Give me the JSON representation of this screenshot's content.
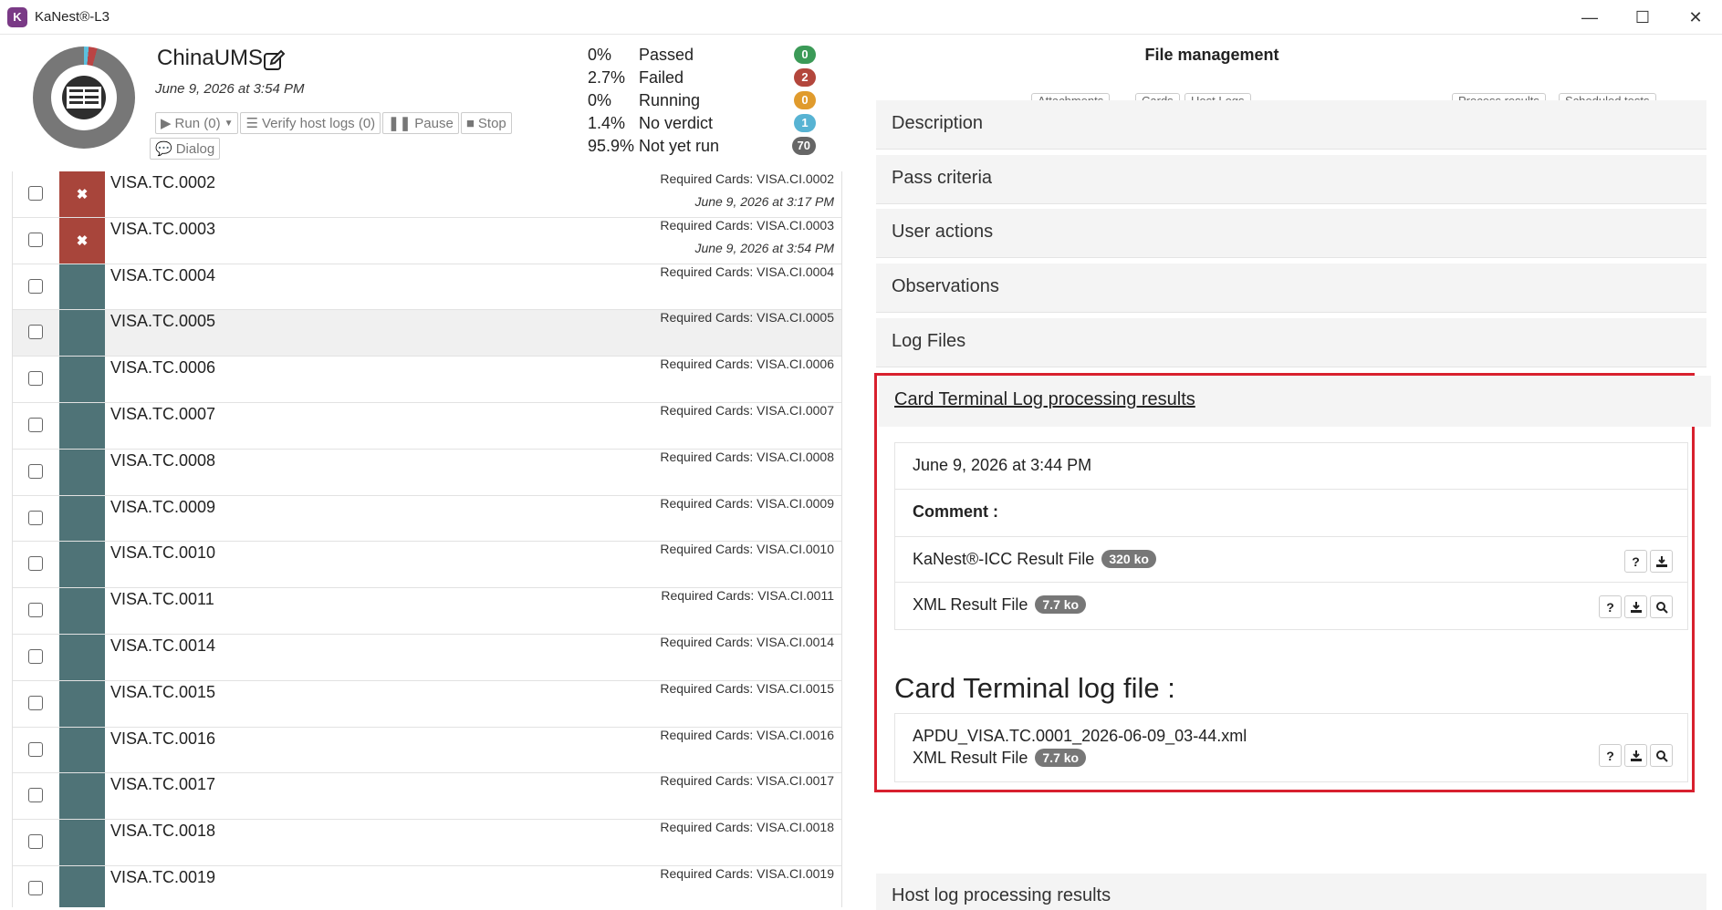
{
  "window": {
    "title": "KaNest®-L3",
    "controls": [
      "—",
      "☐",
      "✕"
    ]
  },
  "project": {
    "name": "ChinaUMS",
    "date": "June 9, 2026 at 3:54 PM",
    "buttons": {
      "run": "Run (0)",
      "verify": "Verify host logs (0)",
      "pause": "Pause",
      "stop": "Stop",
      "dialog": "Dialog"
    }
  },
  "stats": [
    {
      "pct": "0%",
      "label": "Passed",
      "count": "0",
      "color": "#3b9a57"
    },
    {
      "pct": "2.7%",
      "label": "Failed",
      "count": "2",
      "color": "#b3463c"
    },
    {
      "pct": "0%",
      "label": "Running",
      "count": "0",
      "color": "#e09b2d"
    },
    {
      "pct": "1.4%",
      "label": "No verdict",
      "count": "1",
      "color": "#57b3d3"
    },
    {
      "pct": "95.9%",
      "label": "Not yet run",
      "count": "70",
      "color": "#666666"
    }
  ],
  "testcases": [
    {
      "name": "VISA.TC.0002",
      "req": "Required Cards: VISA.CI.0002",
      "date": "June 9, 2026 at 3:17 PM",
      "status": "failed"
    },
    {
      "name": "VISA.TC.0003",
      "req": "Required Cards: VISA.CI.0003",
      "date": "June 9, 2026 at 3:54 PM",
      "status": "failed"
    },
    {
      "name": "VISA.TC.0004",
      "req": "Required Cards: VISA.CI.0004",
      "date": "",
      "status": "notrun"
    },
    {
      "name": "VISA.TC.0005",
      "req": "Required Cards: VISA.CI.0005",
      "date": "",
      "status": "notrun"
    },
    {
      "name": "VISA.TC.0006",
      "req": "Required Cards: VISA.CI.0006",
      "date": "",
      "status": "notrun"
    },
    {
      "name": "VISA.TC.0007",
      "req": "Required Cards: VISA.CI.0007",
      "date": "",
      "status": "notrun"
    },
    {
      "name": "VISA.TC.0008",
      "req": "Required Cards: VISA.CI.0008",
      "date": "",
      "status": "notrun"
    },
    {
      "name": "VISA.TC.0009",
      "req": "Required Cards: VISA.CI.0009",
      "date": "",
      "status": "notrun"
    },
    {
      "name": "VISA.TC.0010",
      "req": "Required Cards: VISA.CI.0010",
      "date": "",
      "status": "notrun"
    },
    {
      "name": "VISA.TC.0011",
      "req": "Required Cards: VISA.CI.0011",
      "date": "",
      "status": "notrun"
    },
    {
      "name": "VISA.TC.0014",
      "req": "Required Cards: VISA.CI.0014",
      "date": "",
      "status": "notrun"
    },
    {
      "name": "VISA.TC.0015",
      "req": "Required Cards: VISA.CI.0015",
      "date": "",
      "status": "notrun"
    },
    {
      "name": "VISA.TC.0016",
      "req": "Required Cards: VISA.CI.0016",
      "date": "",
      "status": "notrun"
    },
    {
      "name": "VISA.TC.0017",
      "req": "Required Cards: VISA.CI.0017",
      "date": "",
      "status": "notrun"
    },
    {
      "name": "VISA.TC.0018",
      "req": "Required Cards: VISA.CI.0018",
      "date": "",
      "status": "notrun"
    },
    {
      "name": "VISA.TC.0019",
      "req": "Required Cards: VISA.CI.0019",
      "date": "",
      "status": "notrun"
    }
  ],
  "file_management": {
    "title": "File management",
    "peek_tabs": [
      "Attachments",
      "Cards",
      "Host Logs",
      "Process results",
      "Scheduled tests"
    ],
    "sections": [
      "Description",
      "Pass criteria",
      "User actions",
      "Observations",
      "Log Files"
    ],
    "ct_results": {
      "title": "Card Terminal Log processing results",
      "date": "June 9, 2026 at 3:44 PM",
      "comment_label": "Comment :",
      "files": [
        {
          "label": "KaNest®-ICC Result File",
          "size": "320 ko"
        },
        {
          "label": "XML Result File",
          "size": "7.7 ko"
        }
      ]
    },
    "ct_log": {
      "title": "Card Terminal log file :",
      "filename": "APDU_VISA.TC.0001_2026-06-09_03-44.xml",
      "xml_label": "XML Result File",
      "xml_size": "7.7 ko"
    },
    "host_results_title": "Host log processing results"
  }
}
